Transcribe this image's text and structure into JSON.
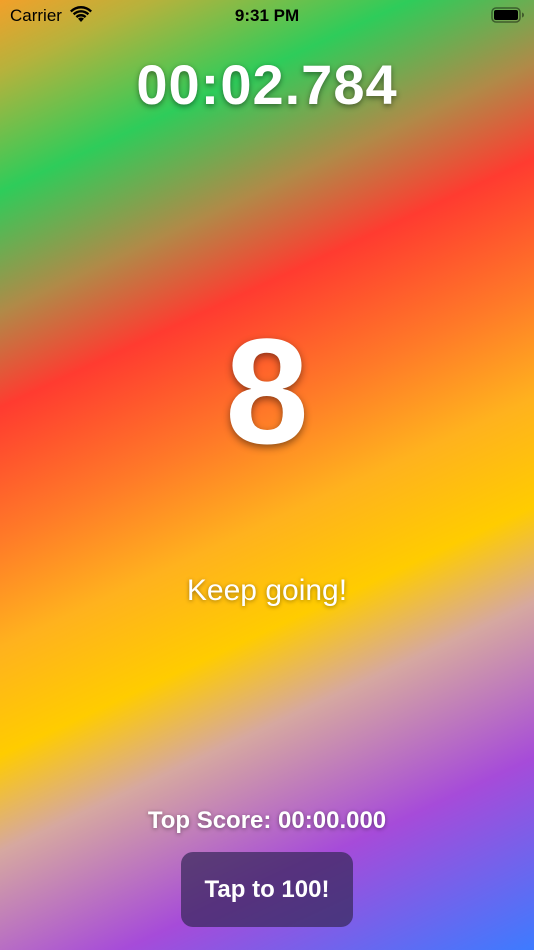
{
  "status_bar": {
    "carrier": "Carrier",
    "time": "9:31 PM",
    "wifi_icon": "wifi-icon",
    "battery_icon": "battery-icon"
  },
  "game": {
    "timer": "00:02.784",
    "count": "8",
    "message": "Keep going!",
    "top_score": "Top Score: 00:00.000",
    "button_label": "Tap to 100!"
  },
  "colors": {
    "text": "#ffffff",
    "button_background": "#37285a",
    "gradient": [
      "#f2a02a",
      "#2ecc5a",
      "#ff3b30",
      "#ffcc00",
      "#a64bd9",
      "#3d7bff"
    ]
  }
}
